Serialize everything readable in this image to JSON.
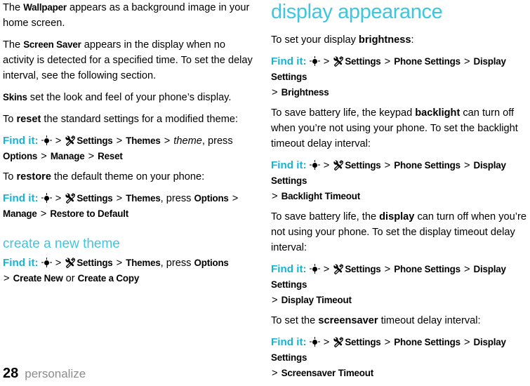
{
  "left_column": {
    "p1": {
      "pre": "The ",
      "term": "Wallpaper",
      "post": " appears as a background image in your home screen."
    },
    "p2": {
      "pre": "The ",
      "term": "Screen Saver",
      "post": " appears in the display when no activity is detected for a specified time. To set the delay interval, see the following section."
    },
    "p3": {
      "term": "Skins",
      "post": " set the look and feel of your phone’s display."
    },
    "p4": {
      "pre": "To ",
      "bold": "reset",
      "post": " the standard settings for a modified theme:"
    },
    "finditA": {
      "label": "Find it:",
      "path": [
        "Settings",
        "Themes",
        "theme"
      ],
      "press_word": ", press",
      "path2": [
        "Options",
        "Manage",
        "Reset"
      ]
    },
    "p5": {
      "pre": "To ",
      "bold": "restore",
      "post": " the default theme on your phone:"
    },
    "finditB": {
      "label": "Find it:",
      "path": [
        "Settings",
        "Themes"
      ],
      "press_word": ", press",
      "path2": [
        "Options",
        "Manage",
        "Restore to Default"
      ]
    },
    "section_title": "create a new theme",
    "finditC": {
      "label": "Find it:",
      "path": [
        "Settings",
        "Themes"
      ],
      "press_word": ", press",
      "path2": [
        "Options"
      ],
      "path3": [
        "Create New"
      ],
      "or_word": " or ",
      "path4": [
        "Create a Copy"
      ]
    }
  },
  "right_column": {
    "title": "display appearance",
    "p1": {
      "pre": "To set your display ",
      "bold": "brightness",
      "post": ":"
    },
    "finditA": {
      "label": "Find it:",
      "path": [
        "Settings",
        "Phone Settings",
        "Display Settings",
        "Brightness"
      ]
    },
    "p2": {
      "pre": "To save battery life, the keypad ",
      "bold": "backlight",
      "post": " can turn off when you’re not using your phone. To set the backlight timeout delay interval:"
    },
    "finditB": {
      "label": "Find it:",
      "path": [
        "Settings",
        "Phone Settings",
        "Display Settings",
        "Backlight Timeout"
      ]
    },
    "p3": {
      "pre": "To save battery life, the ",
      "bold": "display",
      "post": " can turn off when you’re not using your phone. To set the display timeout delay interval:"
    },
    "finditC": {
      "label": "Find it:",
      "path": [
        "Settings",
        "Phone Settings",
        "Display Settings",
        "Display Timeout"
      ]
    },
    "p4": {
      "pre": "To set the ",
      "bold": "screensaver",
      "post": " timeout delay interval:"
    },
    "finditD": {
      "label": "Find it:",
      "path": [
        "Settings",
        "Phone Settings",
        "Display Settings",
        "Screensaver Timeout"
      ]
    }
  },
  "footer": {
    "page_number": "28",
    "chapter": "personalize"
  },
  "icons": {
    "center_key": "center-key-icon",
    "settings": "settings-tools-icon"
  },
  "separator": ">",
  "colors": {
    "accent": "#3ec6e0",
    "findit": "#14b4d2",
    "footer_text": "#8c8c8c"
  }
}
